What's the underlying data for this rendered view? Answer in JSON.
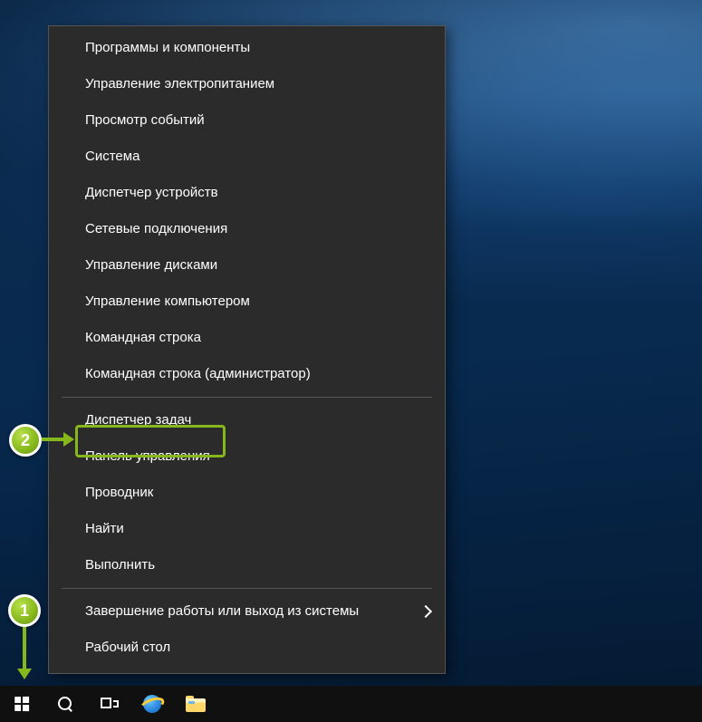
{
  "callouts": {
    "badge1": "1",
    "badge2": "2"
  },
  "menu": {
    "items": [
      {
        "label": "Программы и компоненты",
        "submenu": false
      },
      {
        "label": "Управление электропитанием",
        "submenu": false
      },
      {
        "label": "Просмотр событий",
        "submenu": false
      },
      {
        "label": "Система",
        "submenu": false
      },
      {
        "label": "Диспетчер устройств",
        "submenu": false
      },
      {
        "label": "Сетевые подключения",
        "submenu": false
      },
      {
        "label": "Управление дисками",
        "submenu": false
      },
      {
        "label": "Управление компьютером",
        "submenu": false
      },
      {
        "label": "Командная строка",
        "submenu": false
      },
      {
        "label": "Командная строка (администратор)",
        "submenu": false
      },
      {
        "sep": true
      },
      {
        "label": "Диспетчер задач",
        "submenu": false
      },
      {
        "label": "Панель управления",
        "submenu": false
      },
      {
        "label": "Проводник",
        "submenu": false
      },
      {
        "label": "Найти",
        "submenu": false
      },
      {
        "label": "Выполнить",
        "submenu": false
      },
      {
        "sep": true
      },
      {
        "label": "Завершение работы или выход из системы",
        "submenu": true
      },
      {
        "label": "Рабочий стол",
        "submenu": false
      }
    ]
  }
}
